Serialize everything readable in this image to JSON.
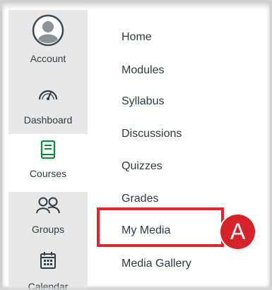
{
  "global_nav": {
    "items": [
      {
        "label": "Account",
        "icon": "account-avatar-icon"
      },
      {
        "label": "Dashboard",
        "icon": "dashboard-gauge-icon"
      },
      {
        "label": "Courses",
        "icon": "courses-book-icon",
        "active": true
      },
      {
        "label": "Groups",
        "icon": "groups-people-icon"
      },
      {
        "label": "Calendar",
        "icon": "calendar-icon"
      }
    ]
  },
  "course_nav": {
    "items": [
      {
        "label": "Home"
      },
      {
        "label": "Modules"
      },
      {
        "label": "Syllabus"
      },
      {
        "label": "Discussions"
      },
      {
        "label": "Quizzes"
      },
      {
        "label": "Grades"
      },
      {
        "label": "My Media"
      },
      {
        "label": "Media Gallery"
      }
    ]
  },
  "callout": {
    "label": "A",
    "color": "#d62229"
  },
  "colors": {
    "sidebar_bg": "#e8e8e8",
    "active_icon": "#0b8a3a",
    "text": "#2d3b45",
    "highlight": "#e0262b"
  }
}
